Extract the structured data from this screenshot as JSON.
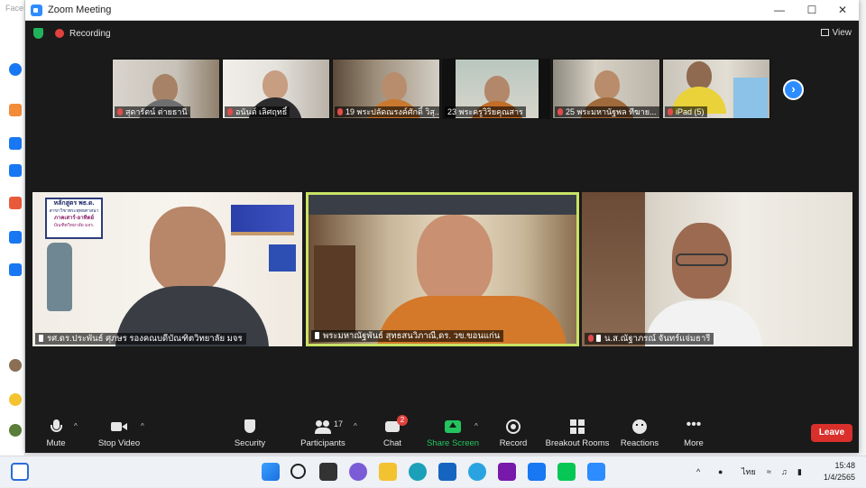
{
  "window": {
    "title": "Zoom Meeting"
  },
  "background": {
    "tab_text": "Face"
  },
  "status": {
    "recording_label": "Recording",
    "view_label": "View"
  },
  "thumbnails": [
    {
      "label": "สุดารัตน์ ต่ายธานี",
      "muted": true
    },
    {
      "label": "อนันต์ เลิศฤทธิ์",
      "muted": true
    },
    {
      "label": "19 พระปลัดณรงค์ศักดิ์ วิสุ...",
      "muted": true
    },
    {
      "label": "23 พระครูวิริยคุณสาร",
      "muted": false
    },
    {
      "label": "25 พระมหานัฐพล ทีฆาย...",
      "muted": true
    },
    {
      "label": "iPad (5)",
      "muted": true
    }
  ],
  "gallery": [
    {
      "label": "รศ.ดร.ประพันธ์ ศุภษร รองคณบดีบัณฑิตวิทยาลัย มจร",
      "active": false,
      "muted": false
    },
    {
      "label": "พระมหาณัฐพันธ์ สุทธสนวิภาณี,ดร. วข.ขอนแก่น",
      "active": true,
      "muted": false
    },
    {
      "label": "น.ส.ณัฐาภรณ์ จันทร์แจ่มธารี",
      "active": false,
      "muted": true
    }
  ],
  "slide": {
    "line1": "หลักสูตร พธ.ด.",
    "line2": "สาขาวิชาพระพุทธศาสนา",
    "line3": "ภาคเสาร์-อาทิตย์",
    "line4": "บัณฑิตวิทยาลัย มจร."
  },
  "toolbar": {
    "mute": "Mute",
    "stop_video": "Stop Video",
    "security": "Security",
    "participants": "Participants",
    "participants_count": "17",
    "chat": "Chat",
    "chat_badge": "2",
    "share_screen": "Share Screen",
    "record": "Record",
    "breakout_rooms": "Breakout Rooms",
    "reactions": "Reactions",
    "more": "More",
    "leave": "Leave"
  },
  "taskbar": {
    "language": "ไทย",
    "time": "15:48",
    "date": "1/4/2565"
  },
  "colors": {
    "accent": "#2d8cff",
    "active_speaker": "#c9e265",
    "leave": "#d9302c",
    "share": "#23c55e",
    "recording": "#e0413e"
  }
}
